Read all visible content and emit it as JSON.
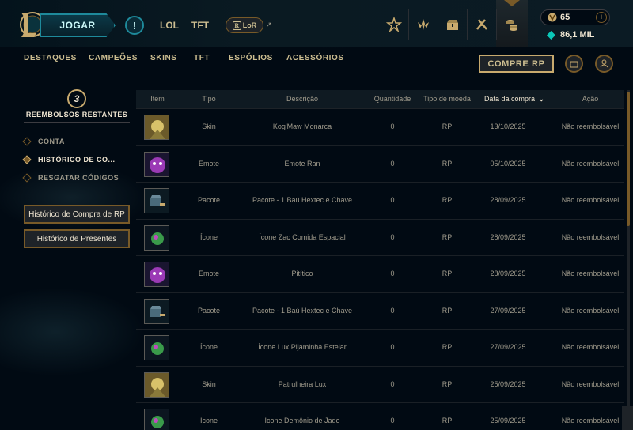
{
  "header": {
    "play_label": "JOGAR",
    "alert_glyph": "!",
    "tabs": [
      "LOL",
      "TFT"
    ],
    "lor_label": "LoR",
    "lor_arrow": "↗",
    "nav_icons": [
      "rank-icon",
      "clash-icon",
      "loot-icon",
      "collection-icon",
      "store-icon"
    ],
    "wallet": {
      "rp": "65",
      "plus": "+",
      "blue_essence": "86,1 MIL"
    }
  },
  "subnav": {
    "items": [
      "DESTAQUES",
      "CAMPEÕES",
      "SKINS",
      "TFT",
      "ESPÓLIOS",
      "ACESSÓRIOS"
    ],
    "buy_rp": "COMPRE RP",
    "gift_icon": "gift-icon",
    "friend_icon": "friend-icon"
  },
  "sidebar": {
    "refunds_count": "3",
    "refunds_label": "REEMBOLSOS RESTANTES",
    "items": [
      {
        "label": "CONTA",
        "active": false
      },
      {
        "label": "HISTÓRICO DE CO...",
        "active": true
      },
      {
        "label": "RESGATAR CÓDIGOS",
        "active": false
      }
    ],
    "buttons": [
      "Histórico de Compra de RP",
      "Histórico de Presentes"
    ]
  },
  "table": {
    "headers": {
      "item": "Item",
      "tipo": "Tipo",
      "descricao": "Descrição",
      "quantidade": "Quantidade",
      "moeda": "Tipo de moeda",
      "data": "Data da compra",
      "acao": "Ação"
    },
    "sort_glyph": "⌄",
    "rows": [
      {
        "tipo": "Skin",
        "descricao": "Kog'Maw Monarca",
        "quantidade": "0",
        "moeda": "RP",
        "data": "13/10/2025",
        "acao": "Não reembolsável",
        "thumb": "skin-thumb"
      },
      {
        "tipo": "Emote",
        "descricao": "Emote Ran",
        "quantidade": "0",
        "moeda": "RP",
        "data": "05/10/2025",
        "acao": "Não reembolsável",
        "thumb": "emote-thumb"
      },
      {
        "tipo": "Pacote",
        "descricao": "Pacote - 1 Baú Hextec e Chave",
        "quantidade": "0",
        "moeda": "RP",
        "data": "28/09/2025",
        "acao": "Não reembolsável",
        "thumb": "chest-thumb"
      },
      {
        "tipo": "Ícone",
        "descricao": "Ícone Zac Comida Espacial",
        "quantidade": "0",
        "moeda": "RP",
        "data": "28/09/2025",
        "acao": "Não reembolsável",
        "thumb": "icon-thumb"
      },
      {
        "tipo": "Emote",
        "descricao": "Pitítico",
        "quantidade": "0",
        "moeda": "RP",
        "data": "28/09/2025",
        "acao": "Não reembolsável",
        "thumb": "emote-thumb"
      },
      {
        "tipo": "Pacote",
        "descricao": "Pacote - 1 Baú Hextec e Chave",
        "quantidade": "0",
        "moeda": "RP",
        "data": "27/09/2025",
        "acao": "Não reembolsável",
        "thumb": "chest-thumb"
      },
      {
        "tipo": "Ícone",
        "descricao": "Ícone Lux Pijaminha Estelar",
        "quantidade": "0",
        "moeda": "RP",
        "data": "27/09/2025",
        "acao": "Não reembolsável",
        "thumb": "icon-thumb"
      },
      {
        "tipo": "Skin",
        "descricao": "Patrulheira Lux",
        "quantidade": "0",
        "moeda": "RP",
        "data": "25/09/2025",
        "acao": "Não reembolsável",
        "thumb": "skin-thumb"
      },
      {
        "tipo": "Ícone",
        "descricao": "Ícone Demônio de Jade",
        "quantidade": "0",
        "moeda": "RP",
        "data": "25/09/2025",
        "acao": "Não reembolsável",
        "thumb": "icon-thumb"
      }
    ]
  },
  "colors": {
    "gold": "#c8aa6e",
    "gold_dark": "#785a28",
    "teal": "#1e8a9b",
    "text": "#a09b8c",
    "text_bright": "#f0e6d2",
    "background": "#010a13"
  }
}
